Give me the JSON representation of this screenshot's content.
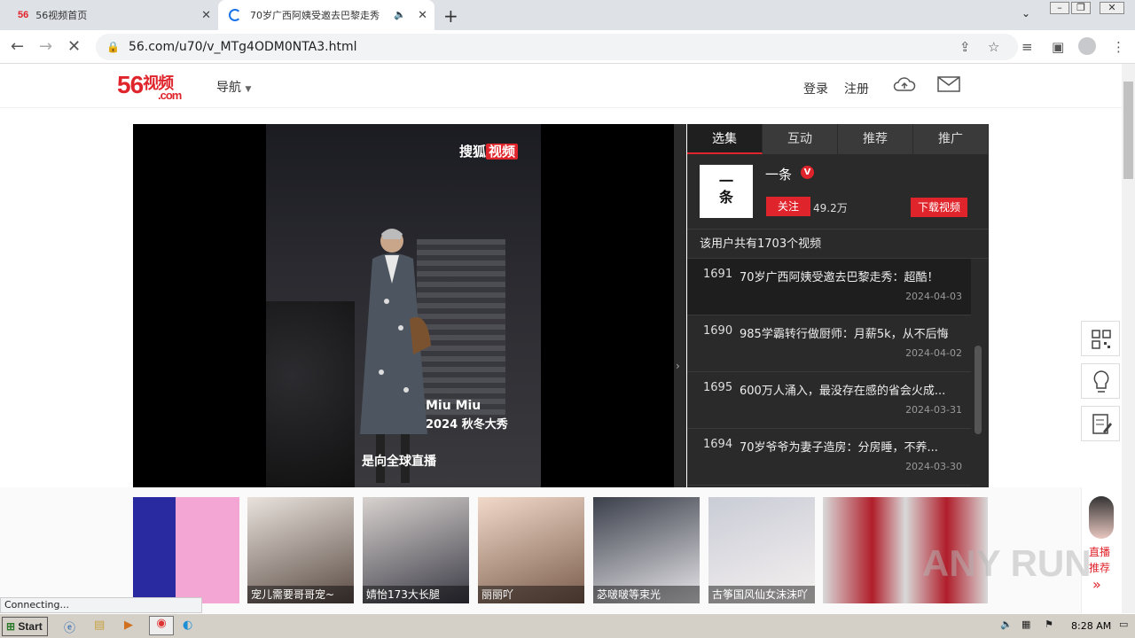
{
  "browser": {
    "tabs": [
      {
        "icon_text": "56",
        "label": "56视频首页"
      },
      {
        "label": "70岁广西阿姨受邀去巴黎走秀"
      }
    ],
    "url": "56.com/u70/v_MTg4ODM0NTA3.html",
    "status": "Connecting..."
  },
  "header": {
    "logo_num": "56",
    "logo_cn": "视频",
    "logo_com": ".com",
    "nav": "导航",
    "login": "登录",
    "register": "注册"
  },
  "video": {
    "watermark_a": "搜狐",
    "watermark_b": "视频",
    "caption1": "Miu Miu",
    "caption2": "2024 秋冬大秀",
    "caption3": "是向全球直播"
  },
  "panel": {
    "tabs": [
      "选集",
      "互动",
      "推荐",
      "推广"
    ],
    "avatar_text_1": "一",
    "avatar_text_2": "条",
    "user_name": "一条",
    "verified_badge": "V",
    "follow_label": "关注",
    "fans": "49.2万",
    "download_label": "下载视频",
    "total": "该用户共有1703个视频",
    "videos": [
      {
        "num": "1691",
        "title": "70岁广西阿姨受邀去巴黎走秀：超酷！",
        "date": "2024-04-03"
      },
      {
        "num": "1690",
        "title": "985学霸转行做厨师：月薪5k，从不后悔",
        "date": "2024-04-02"
      },
      {
        "num": "1695",
        "title": "600万人涌入，最没存在感的省会火成...",
        "date": "2024-03-31"
      },
      {
        "num": "1694",
        "title": "70岁爷爷为妻子造房：分房睡，不养...",
        "date": "2024-03-30"
      }
    ]
  },
  "strip": {
    "thumbs": [
      {
        "label": "宠儿需要哥哥宠~"
      },
      {
        "label": "婧怡173大长腿"
      },
      {
        "label": "丽丽吖"
      },
      {
        "label": "苾啵啵等束光"
      },
      {
        "label": "古筝国风仙女沫沫吖"
      }
    ],
    "live_1": "直播",
    "live_2": "推荐",
    "live_arrow": "»"
  },
  "overlay": {
    "watermark": "ANY RUN"
  },
  "taskbar": {
    "start": "Start",
    "clock": "8:28 AM"
  },
  "colors": {
    "brand_red": "#e0242b",
    "panel_bg": "#2a2a2a",
    "player_bg": "#000000"
  }
}
